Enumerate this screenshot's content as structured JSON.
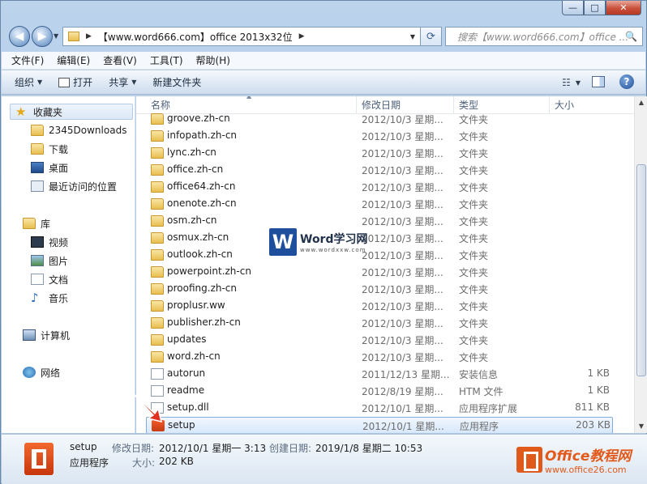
{
  "window": {
    "minimize_label": "—",
    "maximize_label": "□",
    "close_label": "✕"
  },
  "address_bar": {
    "path": "【www.word666.com】office 2013x32位",
    "search_placeholder": "搜索【www.word666.com】office ..."
  },
  "menu": [
    "文件(F)",
    "编辑(E)",
    "查看(V)",
    "工具(T)",
    "帮助(H)"
  ],
  "toolbar": {
    "organize": "组织",
    "open": "打开",
    "share": "共享",
    "new_folder": "新建文件夹"
  },
  "nav": {
    "favorites": "收藏夹",
    "fav_items": [
      "2345Downloads",
      "下载",
      "桌面",
      "最近访问的位置"
    ],
    "libraries": "库",
    "lib_items": [
      "视频",
      "图片",
      "文档",
      "音乐"
    ],
    "computer": "计算机",
    "network": "网络"
  },
  "columns": {
    "name": "名称",
    "date": "修改日期",
    "type": "类型",
    "size": "大小"
  },
  "files": [
    {
      "name": "groove.zh-cn",
      "date": "2012/10/3 星期...",
      "type": "文件夹",
      "size": "",
      "icon": "folder"
    },
    {
      "name": "infopath.zh-cn",
      "date": "2012/10/3 星期...",
      "type": "文件夹",
      "size": "",
      "icon": "folder"
    },
    {
      "name": "lync.zh-cn",
      "date": "2012/10/3 星期...",
      "type": "文件夹",
      "size": "",
      "icon": "folder"
    },
    {
      "name": "office.zh-cn",
      "date": "2012/10/3 星期...",
      "type": "文件夹",
      "size": "",
      "icon": "folder"
    },
    {
      "name": "office64.zh-cn",
      "date": "2012/10/3 星期...",
      "type": "文件夹",
      "size": "",
      "icon": "folder"
    },
    {
      "name": "onenote.zh-cn",
      "date": "2012/10/3 星期...",
      "type": "文件夹",
      "size": "",
      "icon": "folder"
    },
    {
      "name": "osm.zh-cn",
      "date": "2012/10/3 星期...",
      "type": "文件夹",
      "size": "",
      "icon": "folder"
    },
    {
      "name": "osmux.zh-cn",
      "date": "2012/10/3 星期...",
      "type": "文件夹",
      "size": "",
      "icon": "folder"
    },
    {
      "name": "outlook.zh-cn",
      "date": "2012/10/3 星期...",
      "type": "文件夹",
      "size": "",
      "icon": "folder"
    },
    {
      "name": "powerpoint.zh-cn",
      "date": "2012/10/3 星期...",
      "type": "文件夹",
      "size": "",
      "icon": "folder"
    },
    {
      "name": "proofing.zh-cn",
      "date": "2012/10/3 星期...",
      "type": "文件夹",
      "size": "",
      "icon": "folder"
    },
    {
      "name": "proplusr.ww",
      "date": "2012/10/3 星期...",
      "type": "文件夹",
      "size": "",
      "icon": "folder"
    },
    {
      "name": "publisher.zh-cn",
      "date": "2012/10/3 星期...",
      "type": "文件夹",
      "size": "",
      "icon": "folder"
    },
    {
      "name": "updates",
      "date": "2012/10/3 星期...",
      "type": "文件夹",
      "size": "",
      "icon": "folder"
    },
    {
      "name": "word.zh-cn",
      "date": "2012/10/3 星期...",
      "type": "文件夹",
      "size": "",
      "icon": "folder"
    },
    {
      "name": "autorun",
      "date": "2011/12/13 星期...",
      "type": "安装信息",
      "size": "1 KB",
      "icon": "doc"
    },
    {
      "name": "readme",
      "date": "2012/8/19 星期...",
      "type": "HTM 文件",
      "size": "1 KB",
      "icon": "doc"
    },
    {
      "name": "setup.dll",
      "date": "2012/10/1 星期...",
      "type": "应用程序扩展",
      "size": "811 KB",
      "icon": "doc"
    },
    {
      "name": "setup",
      "date": "2012/10/1 星期...",
      "type": "应用程序",
      "size": "203 KB",
      "icon": "exe",
      "selected": true
    }
  ],
  "details": {
    "name": "setup",
    "type": "应用程序",
    "modified_label": "修改日期:",
    "modified": "2012/10/1 星期一 3:13",
    "created_label": "创建日期:",
    "created": "2019/1/8 星期二 10:53",
    "size_label": "大小:",
    "size": "202 KB"
  },
  "watermarks": {
    "word_logo": "W",
    "word_title": "Word学习网",
    "word_url": "www.wordxxw.com",
    "office_title": "Office教程网",
    "office_url": "www.office26.com"
  },
  "colors": {
    "accent": "#1e4f9c",
    "selection": "#d8e8fb",
    "office_orange": "#e05a1b"
  }
}
